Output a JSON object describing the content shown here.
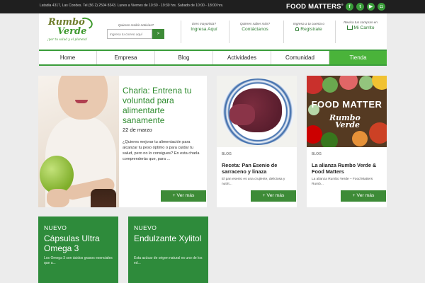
{
  "topbar": {
    "info": "Latadia 4317, Las Condes. Tel (56 2) 2504 8343. Lunes a Viernes de 10:30 - 19:30 hrs. Sabado de 10:00 - 18:00 hrs.",
    "partner_logo": "FOOD MATTERS",
    "partner_logo_mark": "®",
    "social": [
      {
        "icon": "facebook-icon",
        "glyph": "f"
      },
      {
        "icon": "twitter-icon",
        "glyph": "t"
      },
      {
        "icon": "youtube-icon",
        "glyph": "▶"
      },
      {
        "icon": "instagram-icon",
        "glyph": "◘"
      }
    ]
  },
  "header": {
    "logo_line1": "Rumbo",
    "logo_line2": "Verde",
    "logo_tagline": "¡por tu salud y el planeta!",
    "newsletter": {
      "label": "Quieres recibir noticias?",
      "placeholder": "Ingresa tu correo aquí",
      "button": ">"
    },
    "columns": [
      {
        "question": "Eres mayorista?",
        "action": "Ingresa Aquí"
      },
      {
        "question": "Quieres saber más?",
        "action": "Contáctanos"
      },
      {
        "question": "Ingresa a tu cuenta o",
        "action": "Registrate"
      },
      {
        "question": "Revisa tus compras en",
        "action": "Mi Carrito"
      }
    ]
  },
  "nav": {
    "items": [
      "Home",
      "Empresa",
      "Blog",
      "Actividades",
      "Comunidad",
      "Tienda"
    ],
    "active": "Tienda"
  },
  "feature": {
    "title": "Charla: Entrena tu voluntad para alimentarte sanamente",
    "date": "22 de marzo",
    "description": "¿Quieres mejorar tu alimentación para alcanzar tu peso óptimo o para cuidar tu salud, pero no lo consigues? En esta charla comprenderás que, para ...",
    "button": "+ Ver más"
  },
  "cards": [
    {
      "category": "BLOG",
      "title": "Receta: Pan Esenio de sarraceno y linaza",
      "description": "El pan esenio es una crujiente, deliciosa y nutrit...",
      "button": "+ Ver más"
    },
    {
      "category": "BLOG",
      "title": "La alianza Rumbo Verde & Food Matters",
      "description": "La alianza Rumbo Verde – Food Matters Rumb...",
      "button": "+ Ver más",
      "image_text": "FOOD MATTER",
      "image_logo_line1": "Rumbo",
      "image_logo_line2": "Verde"
    }
  ],
  "products": [
    {
      "tag": "NUEVO",
      "title": "Cápsulas Ultra Omega 3",
      "description": "Los Omega 3 son ácidos grasos esenciales que a..."
    },
    {
      "tag": "NUEVO",
      "title": "Endulzante Xylitol",
      "description": "Esta azúcar de origen natural es uno de los ed..."
    }
  ],
  "colors": {
    "brand_green": "#3d8b37",
    "nav_active": "#4ab33a",
    "topbar": "#1f1f1f",
    "product_card": "#2e8b3b"
  }
}
